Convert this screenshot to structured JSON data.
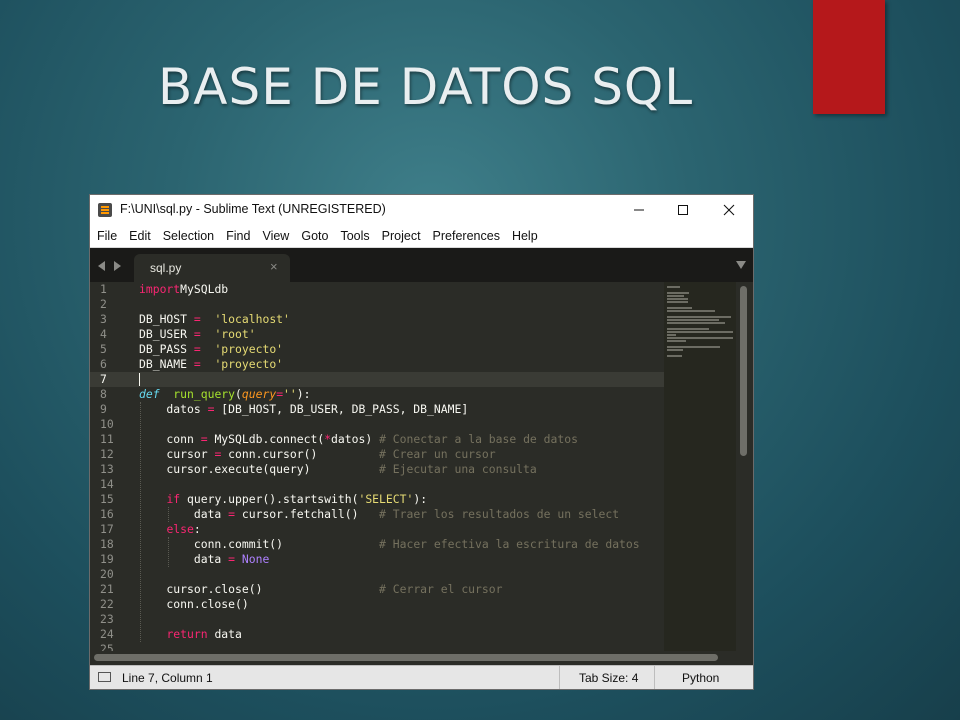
{
  "slide": {
    "title": "BASE DE DATOS SQL",
    "accent_color": "#b5181b"
  },
  "window": {
    "title": "F:\\UNI\\sql.py - Sublime Text (UNREGISTERED)",
    "menu": [
      "File",
      "Edit",
      "Selection",
      "Find",
      "View",
      "Goto",
      "Tools",
      "Project",
      "Preferences",
      "Help"
    ],
    "tab": {
      "label": "sql.py",
      "close": "×"
    }
  },
  "editor": {
    "line_numbers": [
      "1",
      "2",
      "3",
      "4",
      "5",
      "6",
      "7",
      "8",
      "9",
      "10",
      "11",
      "12",
      "13",
      "14",
      "15",
      "16",
      "17",
      "18",
      "19",
      "20",
      "21",
      "22",
      "23",
      "24",
      "25"
    ],
    "current_line": 7
  },
  "status": {
    "position": "Line 7, Column 1",
    "tab_size": "Tab Size: 4",
    "syntax": "Python"
  }
}
